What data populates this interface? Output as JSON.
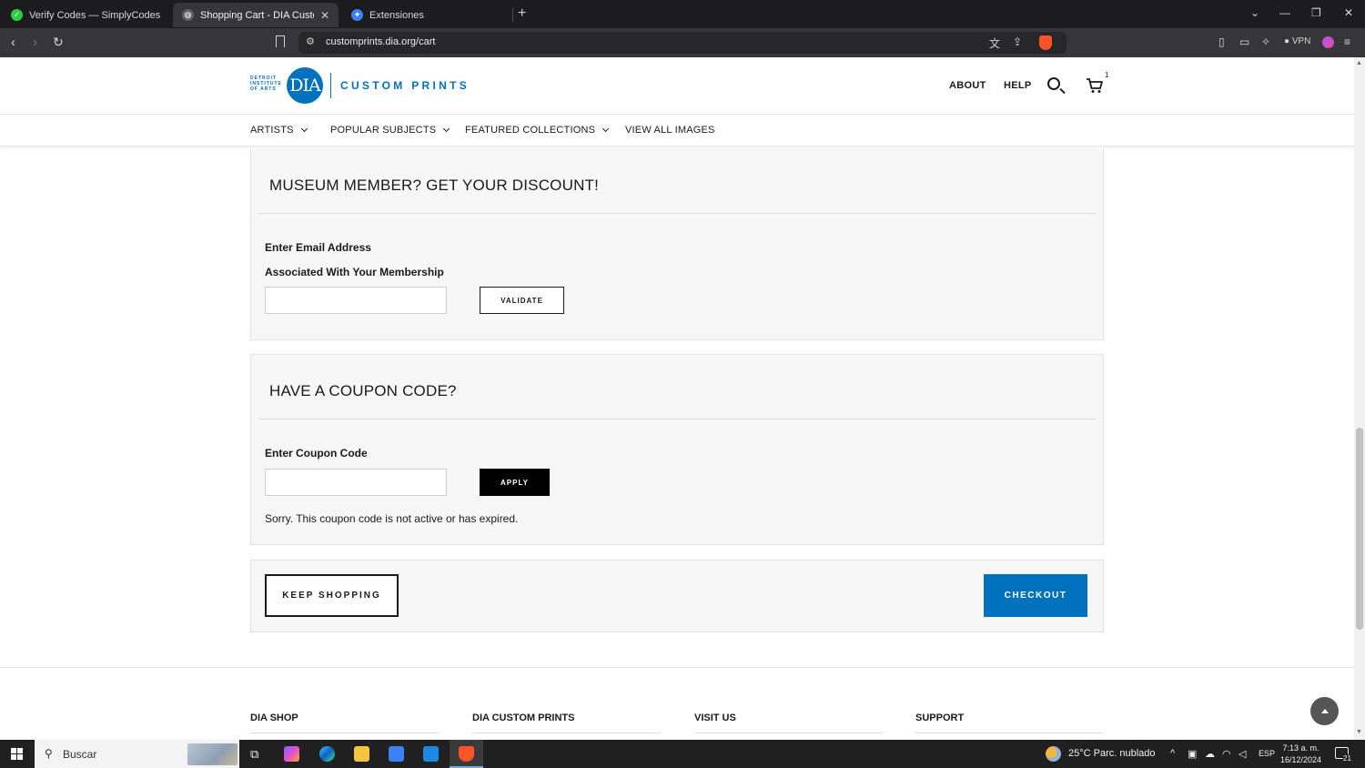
{
  "browser": {
    "tabs": [
      {
        "title": "Verify Codes — SimplyCodes",
        "favicon_color": "#2ecc40"
      },
      {
        "title": "Shopping Cart - DIA Custom Pr",
        "favicon_color": "#5f6368"
      },
      {
        "title": "Extensiones",
        "favicon_color": "#3b82f6"
      }
    ],
    "new_tab_label": "+",
    "url": "customprints.dia.org/cart",
    "vpn_label": "VPN",
    "brave_badge": "1"
  },
  "header": {
    "logo_small": "DETROIT INSTITUTE OF ARTS",
    "logo_mark": "DIA",
    "logo_text": "CUSTOM PRINTS",
    "links": {
      "about": "ABOUT",
      "help": "HELP"
    },
    "cart_count": "1",
    "brand_color": "#0071bc"
  },
  "nav": {
    "items": [
      {
        "label": "ARTISTS",
        "has_dropdown": true
      },
      {
        "label": "POPULAR SUBJECTS",
        "has_dropdown": true
      },
      {
        "label": "FEATURED COLLECTIONS",
        "has_dropdown": true
      },
      {
        "label": "VIEW ALL IMAGES",
        "has_dropdown": false
      }
    ]
  },
  "member": {
    "title": "MUSEUM MEMBER? GET YOUR DISCOUNT!",
    "label_line1": "Enter Email Address",
    "label_line2": "Associated With Your Membership",
    "email_value": "",
    "validate_label": "VALIDATE"
  },
  "coupon": {
    "title": "HAVE A COUPON CODE?",
    "label": "Enter Coupon Code",
    "code_value": "",
    "apply_label": "APPLY",
    "message": "Sorry. This coupon code is not active or has expired."
  },
  "actions": {
    "keep_shopping_label": "KEEP SHOPPING",
    "checkout_label": "CHECKOUT"
  },
  "footer": {
    "columns": [
      "DIA SHOP",
      "DIA CUSTOM PRINTS",
      "VISIT US",
      "SUPPORT"
    ]
  },
  "taskbar": {
    "search_placeholder": "Buscar",
    "weather": "25°C  Parc. nublado",
    "language": "ESP",
    "time": "7:13 a. m.",
    "date": "16/12/2024",
    "notification_count": "21"
  }
}
